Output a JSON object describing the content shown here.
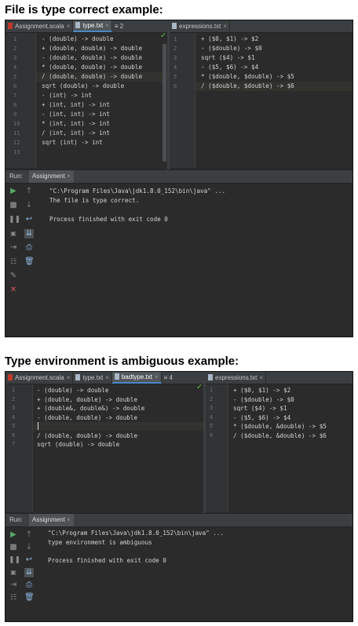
{
  "sections": [
    {
      "title": "File is type correct example:",
      "tabs_left": [
        {
          "label": "Assignment.scala",
          "active": false
        },
        {
          "label": "type.txt",
          "active": true
        }
      ],
      "tab_overflow": "≡ 2",
      "tabs_right": [
        {
          "label": "expressions.txt",
          "active": false
        }
      ],
      "left_lines": [
        "1",
        "2",
        "3",
        "4",
        "5",
        "6",
        "7",
        "8",
        "9",
        "10",
        "11",
        "12",
        "13"
      ],
      "left_code": [
        "- (double) -> double",
        "+ (double, double) -> double",
        "- (double, double) -> double",
        "* (double, double) -> double",
        "/ (double, double) -> double",
        "sqrt (double) -> double",
        "- (int) -> int",
        "+ (int, int) -> int",
        "- (int, int) -> int",
        "* (int, int) -> int",
        "/ (int, int) -> int",
        "sqrt (int) -> int",
        ""
      ],
      "right_lines": [
        "1",
        "2",
        "3",
        "4",
        "5",
        "6"
      ],
      "right_code": [
        "+ ($0, $1) -> $2",
        "- ($double) -> $0",
        "sqrt ($4) -> $1",
        "- ($5, $6) -> $4",
        "* ($double, $double) -> $5",
        "/ ($double, $double) -> $6"
      ],
      "run_label": "Run:",
      "run_tab": "Assignment",
      "console": [
        "\"C:\\Program Files\\Java\\jdk1.8.0_152\\bin\\java\" ...",
        "The file is type correct.",
        "",
        "Process finished with exit code 0"
      ]
    },
    {
      "title": "Type environment is ambiguous example:",
      "tabs_left": [
        {
          "label": "Assignment.scala",
          "active": false
        },
        {
          "label": "type.txt",
          "active": false
        },
        {
          "label": "badtype.txt",
          "active": true
        }
      ],
      "tab_overflow": "≡ 4",
      "tabs_right": [
        {
          "label": "expressions.txt",
          "active": false
        }
      ],
      "left_lines": [
        "1",
        "2",
        "3",
        "4",
        "5",
        "6",
        "7"
      ],
      "left_code": [
        "- (double) -> double",
        "+ (double, double) -> double",
        "+ (double&, double&) -> double",
        "- (double, double) -> double",
        "",
        "/ (double, double) -> double",
        "sqrt (double) -> double"
      ],
      "right_lines": [
        "1",
        "2",
        "3",
        "4",
        "5",
        "6"
      ],
      "right_code": [
        "+ ($0, $1) -> $2",
        "- ($double) -> $0",
        "sqrt ($4) -> $1",
        "- ($5, $6) -> $4",
        "* ($double, &double) -> $5",
        "/ ($double, &double) -> $6"
      ],
      "run_label": "Run:",
      "run_tab": "Assignment",
      "console": [
        "\"C:\\Program Files\\Java\\jdk1.8.0_152\\bin\\java\" ...",
        "type environment is ambiguous",
        "",
        "Process finished with exit code 0"
      ]
    }
  ],
  "colors": {
    "run_green": "#59a869",
    "stop_red": "#db5860",
    "active_tab_underline": "#4a88c7"
  },
  "icons": [
    "scala-file-icon",
    "text-file-icon",
    "close-icon",
    "checkmark-icon",
    "run-icon",
    "stop-icon",
    "pause-icon",
    "rerun-icon",
    "up-arrow-icon",
    "down-arrow-icon",
    "wrap-icon",
    "print-icon",
    "trash-icon",
    "pin-icon",
    "close-red-icon"
  ]
}
